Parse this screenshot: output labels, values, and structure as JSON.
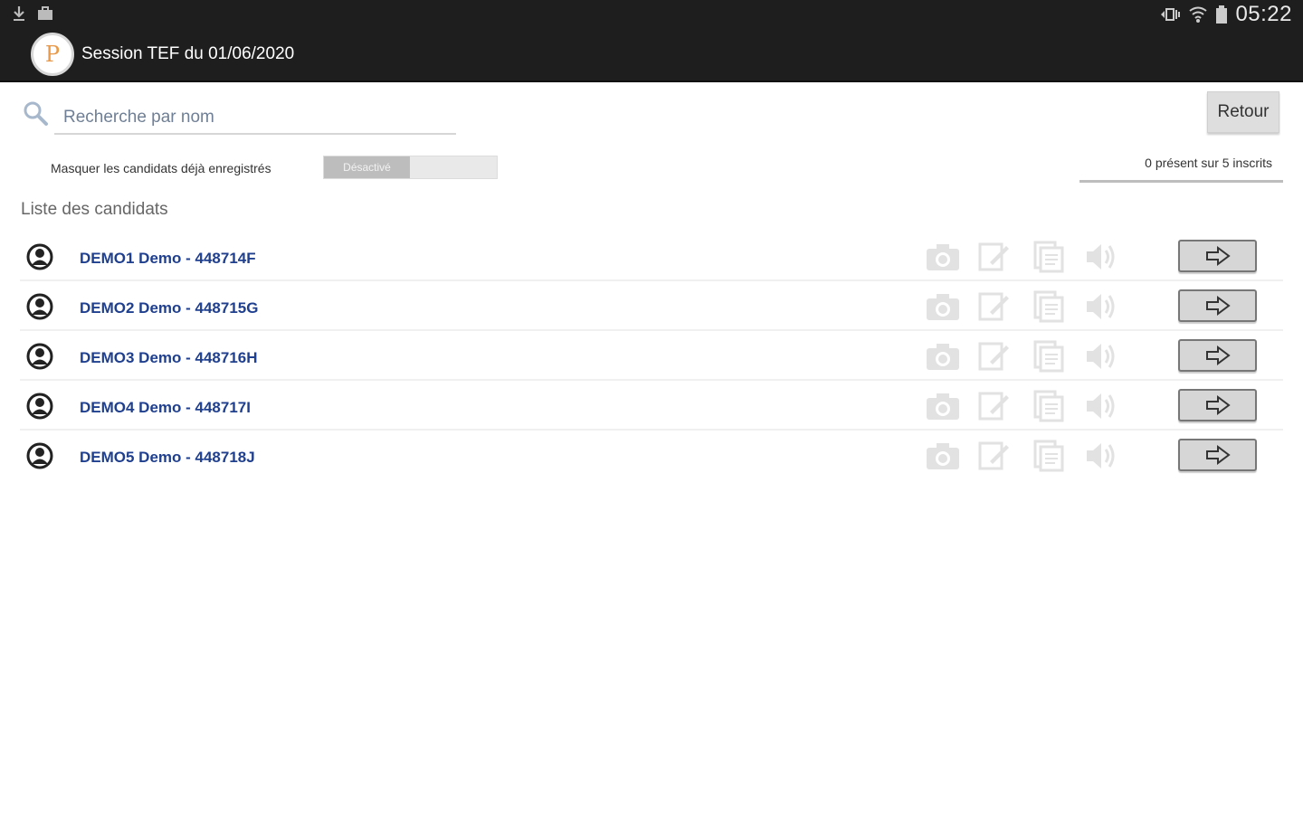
{
  "status_bar": {
    "time": "05:22"
  },
  "app_bar": {
    "logo_letter": "P",
    "title": "Session TEF du 01/06/2020"
  },
  "search": {
    "placeholder": "Recherche par nom"
  },
  "retour_label": "Retour",
  "filter": {
    "label": "Masquer les candidats déjà enregistrés",
    "toggle_state": "Désactivé"
  },
  "attendance": "0 présent sur 5 inscrits",
  "list_title": "Liste des candidats",
  "candidates": [
    {
      "name": "DEMO1 Demo - 448714F"
    },
    {
      "name": "DEMO2 Demo - 448715G"
    },
    {
      "name": "DEMO3 Demo - 448716H"
    },
    {
      "name": "DEMO4 Demo - 448717I"
    },
    {
      "name": "DEMO5 Demo - 448718J"
    }
  ],
  "colors": {
    "bar": "#1e1e1e",
    "candidate_link": "#1f3f8f",
    "icon_disabled": "#dddddd"
  },
  "icons": [
    "download-icon",
    "briefcase-icon",
    "mute-icon",
    "wifi-icon",
    "battery-icon",
    "search-icon",
    "candidate-icon",
    "camera-icon",
    "edit-icon",
    "document-icon",
    "speaker-icon",
    "arrow-right-icon"
  ]
}
